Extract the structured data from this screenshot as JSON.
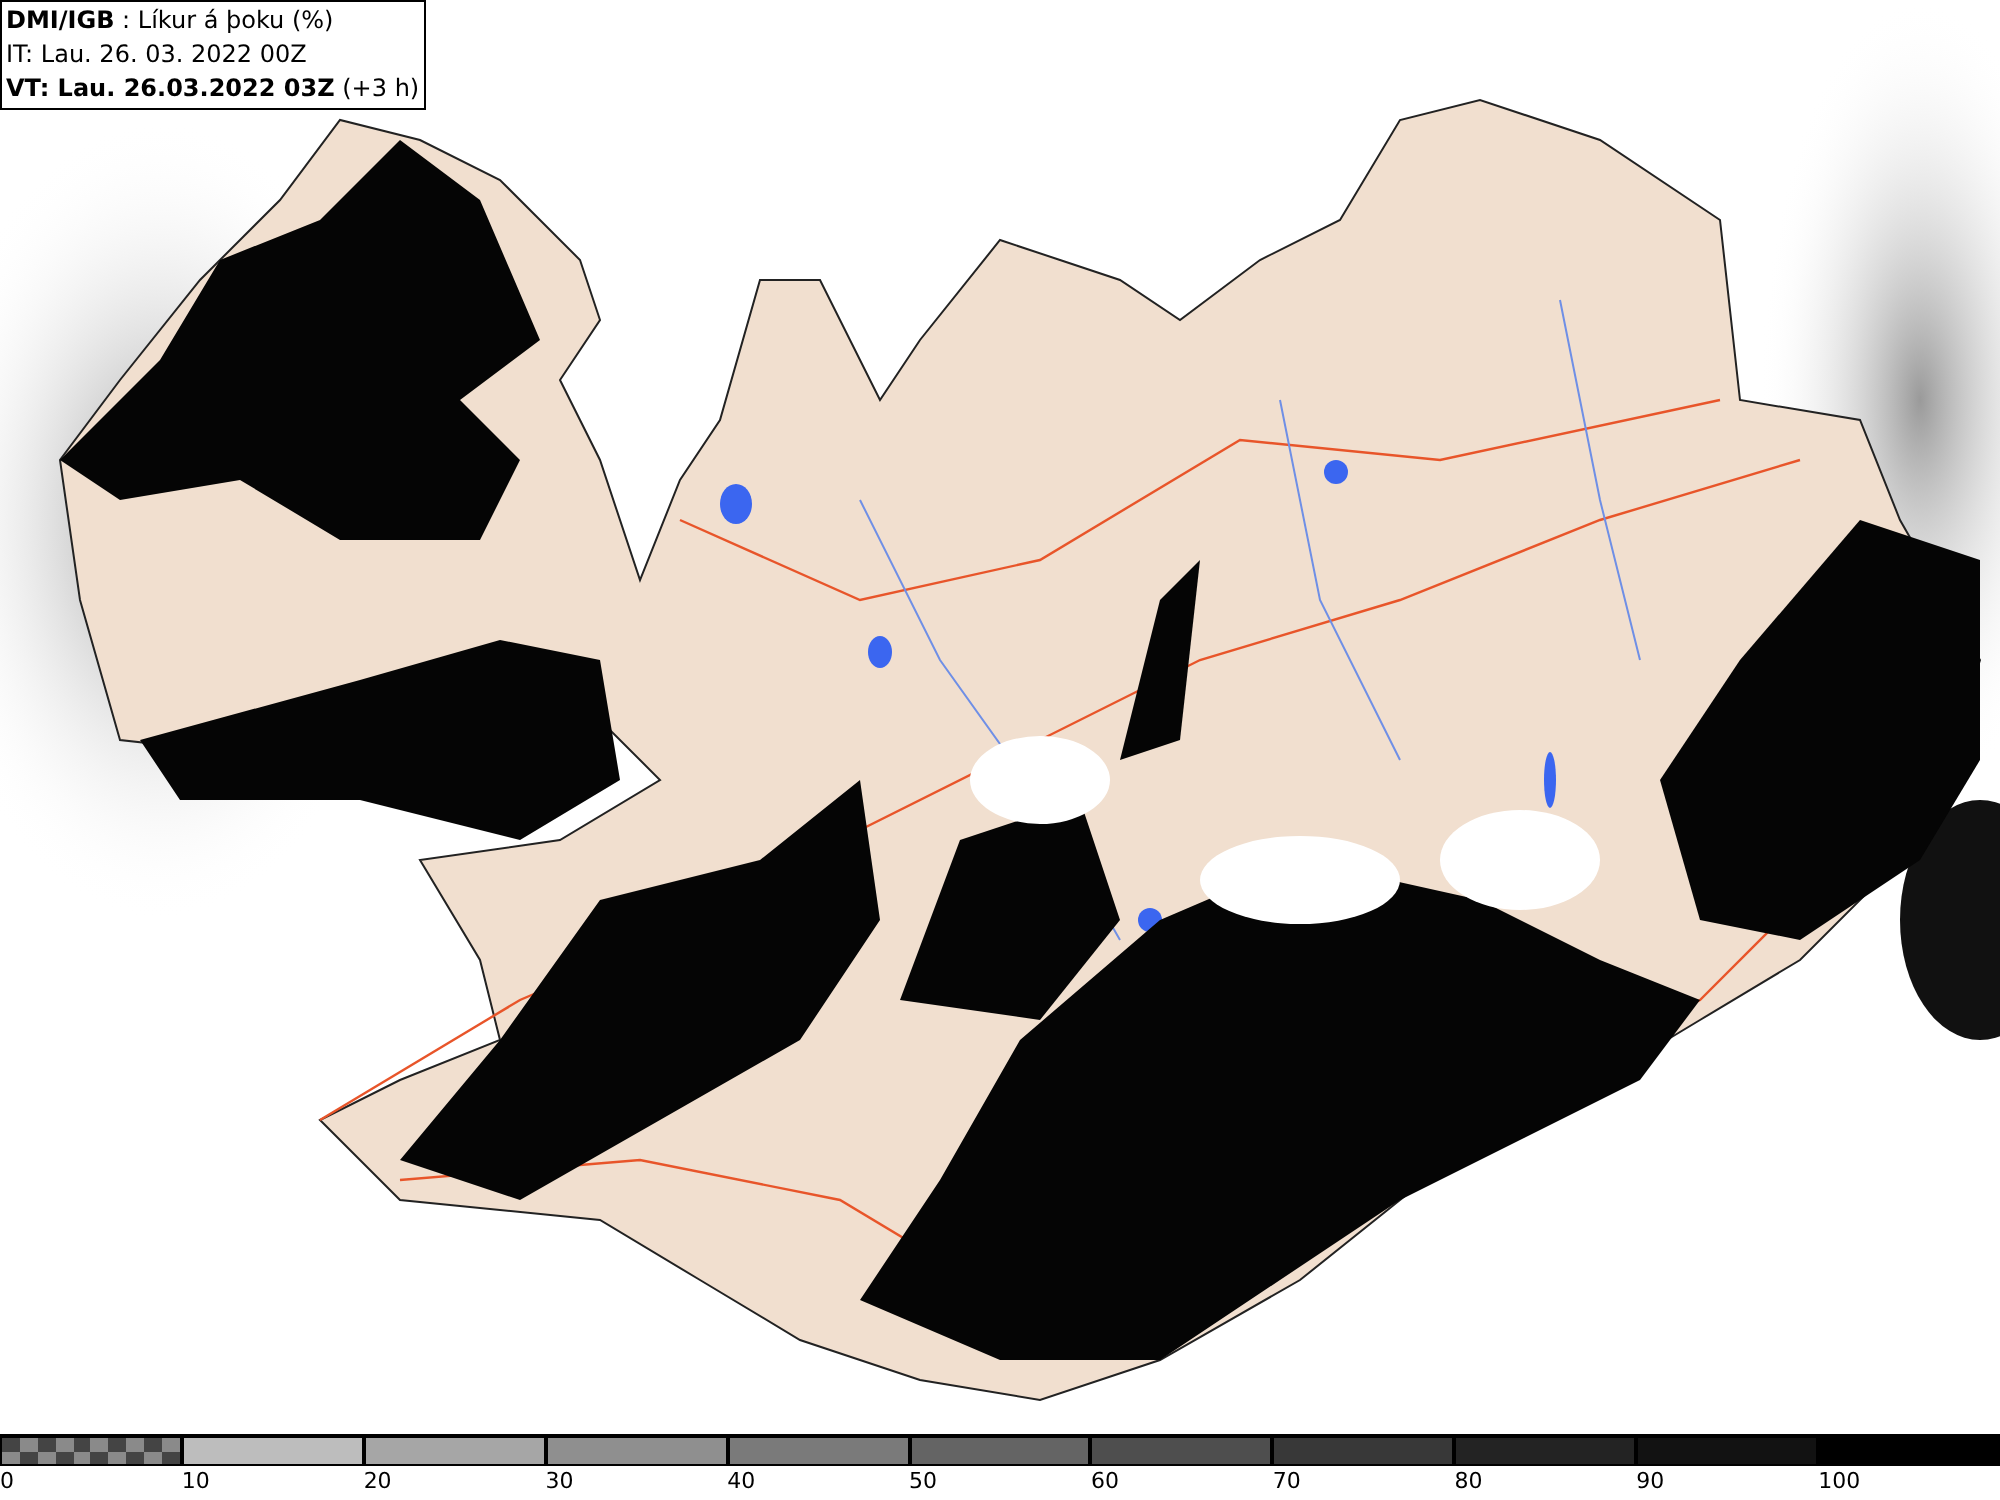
{
  "info_box": {
    "lines": [
      "**DMI/IGB** : Líkur á þoku (%)",
      "IT: Lau. 26. 03. 2022 00Z",
      "**VT: Lau. 26.03.2022 03Z** (+3 h)"
    ]
  },
  "legend": {
    "segments": [
      {
        "kind": "checker",
        "color": "#8a8a8a",
        "label": "0"
      },
      {
        "kind": "solid",
        "color": "#bdbdbd",
        "label": "10"
      },
      {
        "kind": "solid",
        "color": "#a6a6a6",
        "label": "20"
      },
      {
        "kind": "solid",
        "color": "#8f8f8f",
        "label": "30"
      },
      {
        "kind": "solid",
        "color": "#7a7a7a",
        "label": "40"
      },
      {
        "kind": "solid",
        "color": "#646464",
        "label": "50"
      },
      {
        "kind": "solid",
        "color": "#4e4e4e",
        "label": "60"
      },
      {
        "kind": "solid",
        "color": "#383838",
        "label": "70"
      },
      {
        "kind": "solid",
        "color": "#232323",
        "label": "80"
      },
      {
        "kind": "solid",
        "color": "#121212",
        "label": "90"
      },
      {
        "kind": "solid",
        "color": "#000000",
        "label": "100"
      }
    ]
  }
}
